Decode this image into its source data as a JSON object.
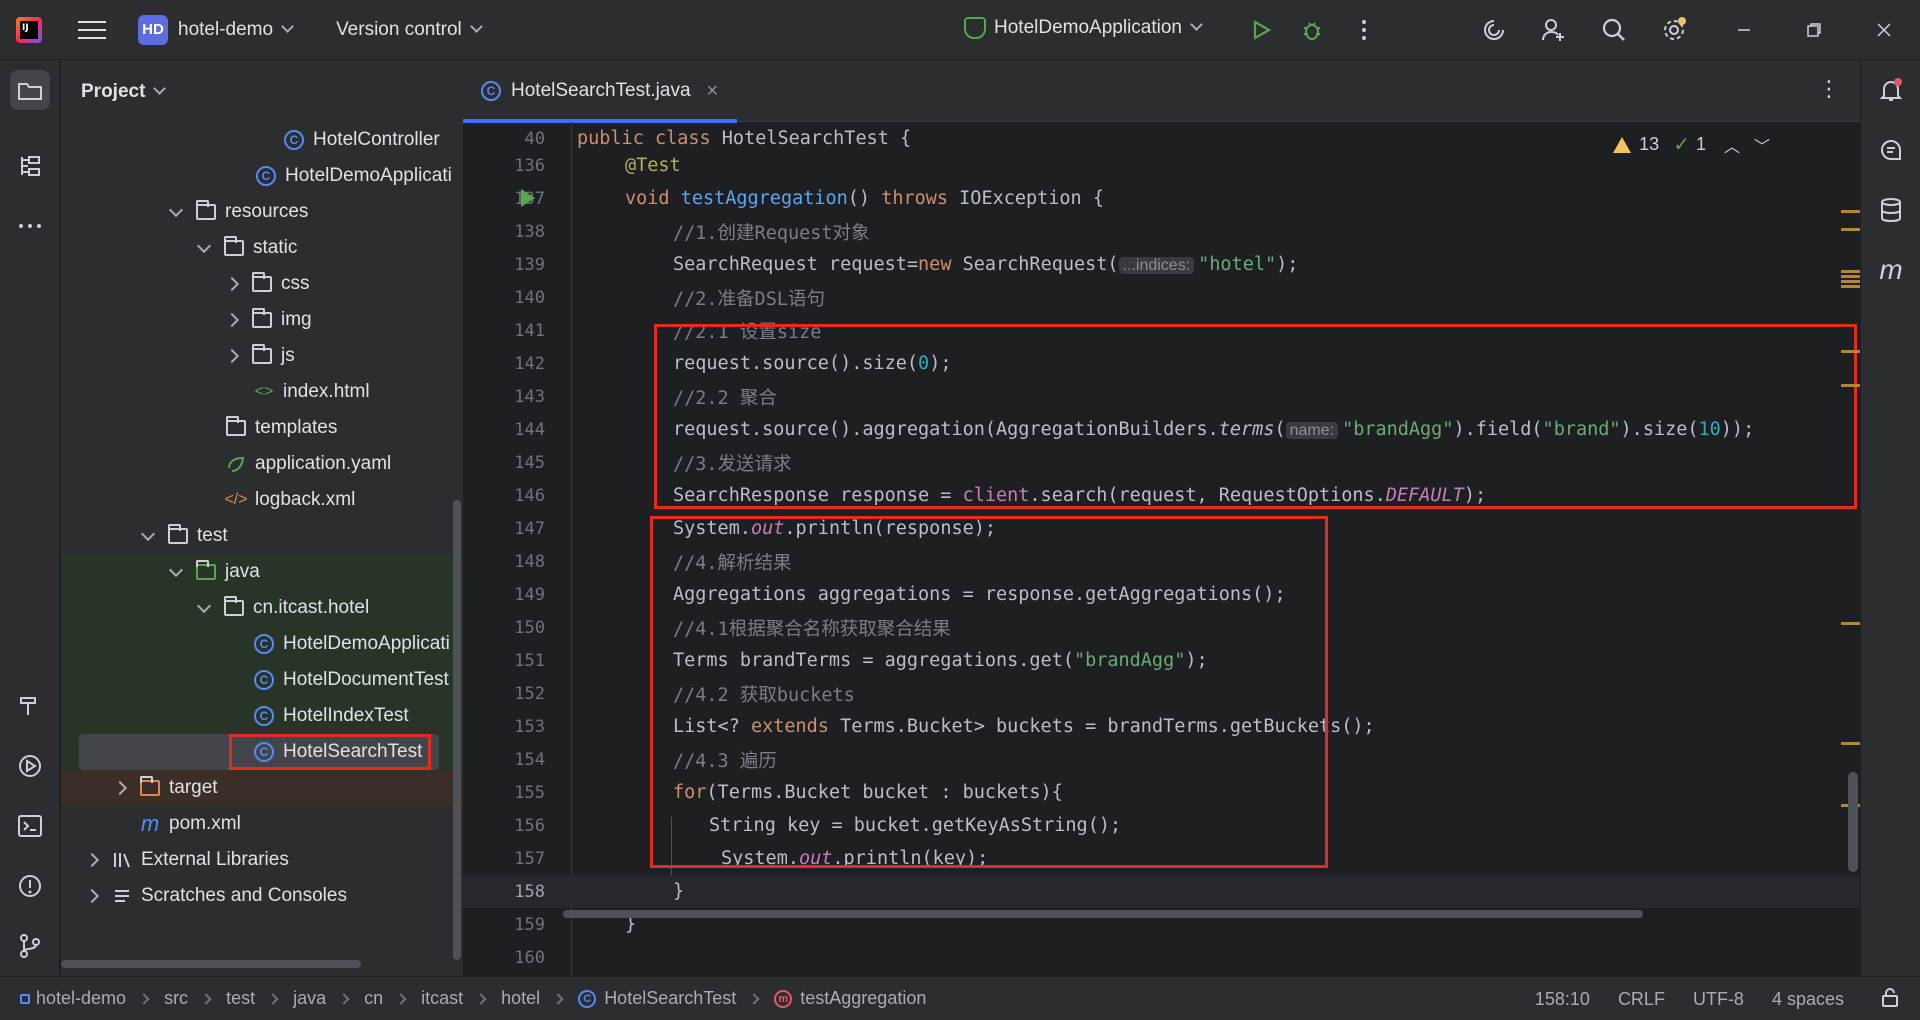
{
  "titlebar": {
    "logo_letters": "IJ",
    "project_badge": "HD",
    "project_name": "hotel-demo",
    "vcs": "Version control",
    "run_config": "HotelDemoApplication"
  },
  "project_panel": {
    "title": "Project",
    "items": [
      {
        "label": "HotelController"
      },
      {
        "label": "HotelDemoApplicati"
      },
      {
        "label": "resources"
      },
      {
        "label": "static"
      },
      {
        "label": "css"
      },
      {
        "label": "img"
      },
      {
        "label": "js"
      },
      {
        "label": "index.html"
      },
      {
        "label": "templates"
      },
      {
        "label": "application.yaml"
      },
      {
        "label": "logback.xml"
      },
      {
        "label": "test"
      },
      {
        "label": "java"
      },
      {
        "label": "cn.itcast.hotel"
      },
      {
        "label": "HotelDemoApplicati"
      },
      {
        "label": "HotelDocumentTest"
      },
      {
        "label": "HotelIndexTest"
      },
      {
        "label": "HotelSearchTest"
      },
      {
        "label": "target"
      },
      {
        "label": "pom.xml"
      },
      {
        "label": "External Libraries"
      },
      {
        "label": "Scratches and Consoles"
      }
    ]
  },
  "editor": {
    "tab_label": "HotelSearchTest.java",
    "warnings": "13",
    "checks": "1",
    "sticky_line_number": "40",
    "line_numbers": [
      "136",
      "137",
      "138",
      "139",
      "140",
      "141",
      "142",
      "143",
      "144",
      "145",
      "146",
      "147",
      "148",
      "149",
      "150",
      "151",
      "152",
      "153",
      "154",
      "155",
      "156",
      "157",
      "158",
      "159",
      "160"
    ],
    "code": {
      "sticky_kw": "public class",
      "sticky_name": " HotelSearchTest {",
      "l136": "@Test",
      "l137_void": "void ",
      "l137_fn": "testAggregation",
      "l137_mid": "() ",
      "l137_throws": "throws",
      "l137_end": " IOException {",
      "l138": "//1.创建Request对象",
      "l139_a": "SearchRequest request=",
      "l139_new": "new",
      "l139_b": " SearchRequest(",
      "l139_hint": "...indices:",
      "l139_str": "\"hotel\"",
      "l139_end": ");",
      "l140": "//2.准备DSL语句",
      "l141": "//2.1 设置size",
      "l142_a": "request.source().size(",
      "l142_num": "0",
      "l142_end": ");",
      "l143": "//2.2 聚合",
      "l144_a": "request.source().aggregation(AggregationBuilders.",
      "l144_it": "terms",
      "l144_b": "(",
      "l144_hint": "name:",
      "l144_str": "\"brandAgg\"",
      "l144_c": ").field(",
      "l144_str2": "\"brand\"",
      "l144_d": ").size(",
      "l144_num": "10",
      "l144_end": "));",
      "l145": "//3.发送请求",
      "l146_a": "SearchResponse response = ",
      "l146_fld": "client",
      "l146_b": ".search(request, RequestOptions.",
      "l146_it": "DEFAULT",
      "l146_end": ");",
      "l147_a": "System.",
      "l147_out": "out",
      "l147_end": ".println(response);",
      "l148": "//4.解析结果",
      "l149": "Aggregations aggregations = response.getAggregations();",
      "l150": "//4.1根据聚合名称获取聚合结果",
      "l151_a": "Terms brandTerms = aggregations.get(",
      "l151_str": "\"brandAgg\"",
      "l151_end": ");",
      "l152": "//4.2 获取buckets",
      "l153_a": "List<? ",
      "l153_kw": "extends",
      "l153_end": " Terms.Bucket> buckets = brandTerms.getBuckets();",
      "l154": "//4.3 遍历",
      "l155_kw": "for",
      "l155_end": "(Terms.Bucket bucket : buckets){",
      "l156": "String key = bucket.getKeyAsString();",
      "l157_a": "System.",
      "l157_out": "out",
      "l157_end": ".println(key);",
      "l158": "}",
      "l159": "}"
    }
  },
  "statusbar": {
    "breadcrumbs": [
      "hotel-demo",
      "src",
      "test",
      "java",
      "cn",
      "itcast",
      "hotel",
      "HotelSearchTest",
      "testAggregation"
    ],
    "position": "158:10",
    "line_sep": "CRLF",
    "encoding": "UTF-8",
    "indent": "4 spaces"
  }
}
